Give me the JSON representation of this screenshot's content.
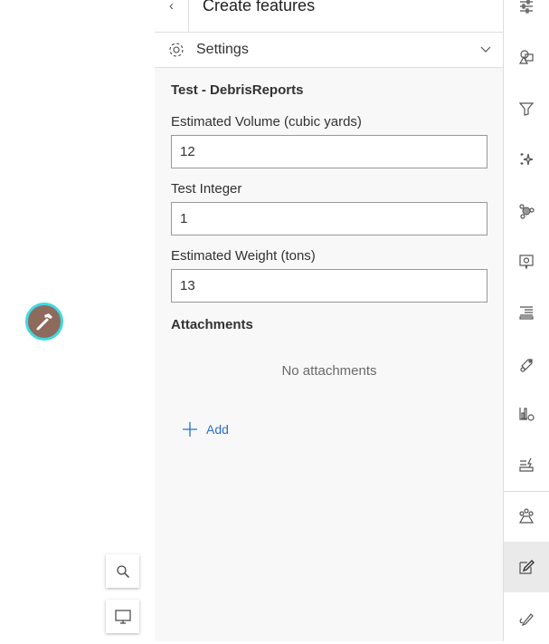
{
  "header": {
    "title": "Create features",
    "back_icon": "chevron-left-icon"
  },
  "settings": {
    "label": "Settings",
    "icon": "gear-icon",
    "toggle_icon": "chevron-down-icon"
  },
  "form": {
    "layer_title": "Test - DebrisReports",
    "fields": [
      {
        "label": "Estimated Volume (cubic yards)",
        "value": "12"
      },
      {
        "label": "Test Integer",
        "value": "1"
      },
      {
        "label": "Estimated Weight (tons)",
        "value": "13"
      }
    ],
    "attachments": {
      "title": "Attachments",
      "empty_text": "No attachments",
      "add_label": "Add"
    }
  },
  "map": {
    "marker_icon": "hammer-icon",
    "buttons": [
      "search-icon",
      "monitor-icon"
    ]
  },
  "toolbar": {
    "items": [
      "sliders-icon",
      "shapes-icon",
      "filter-icon",
      "sparkle-icon",
      "cluster-icon",
      "popup-settings-icon",
      "list-icon",
      "label-icon",
      "chart-settings-icon",
      "form-lightning-icon",
      "elevation-icon",
      "edit-icon",
      "sketch-icon"
    ],
    "active": "edit-icon"
  },
  "colors": {
    "accent": "#2a6fc9",
    "marker": "#8d6a5c",
    "marker_ring": "#3fd9e0"
  }
}
